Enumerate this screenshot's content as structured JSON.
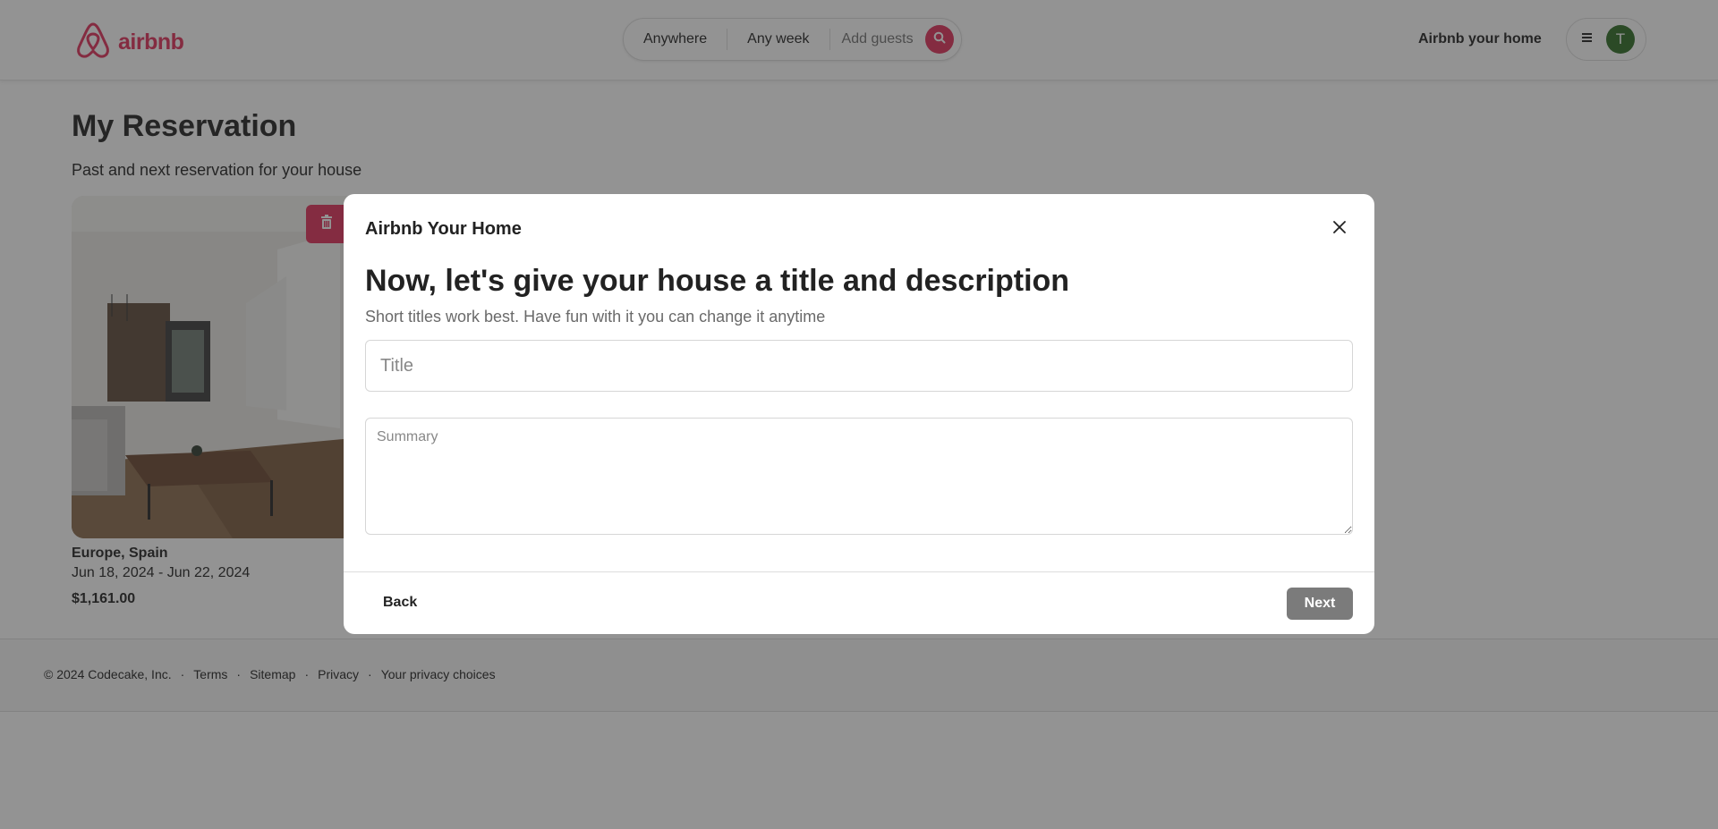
{
  "header": {
    "brand": "airbnb",
    "search": {
      "anywhere": "Anywhere",
      "any_week": "Any week",
      "add_guests": "Add guests"
    },
    "host_link": "Airbnb your home",
    "avatar_initial": "T"
  },
  "page": {
    "title": "My Reservation",
    "subtitle": "Past and next reservation for your house"
  },
  "reservation": {
    "location": "Europe, Spain",
    "dates": "Jun 18, 2024 - Jun 22, 2024",
    "price": "$1,161.00"
  },
  "footer": {
    "copyright": "© 2024 Codecake, Inc.",
    "links": [
      "Terms",
      "Sitemap",
      "Privacy",
      "Your privacy choices"
    ]
  },
  "modal": {
    "title": "Airbnb Your Home",
    "heading": "Now, let's give your house a title and description",
    "subheading": "Short titles work best. Have fun with it you can change it anytime",
    "title_placeholder": "Title",
    "summary_placeholder": "Summary",
    "back_label": "Back",
    "next_label": "Next"
  },
  "colors": {
    "brand": "#e0305a",
    "avatar": "#2e6d24",
    "next_disabled": "#7b7b7b"
  },
  "icons": {
    "logo": "airbnb-logo-icon",
    "search": "search-icon",
    "menu": "hamburger-menu-icon",
    "delete": "trash-icon",
    "close": "close-icon"
  }
}
